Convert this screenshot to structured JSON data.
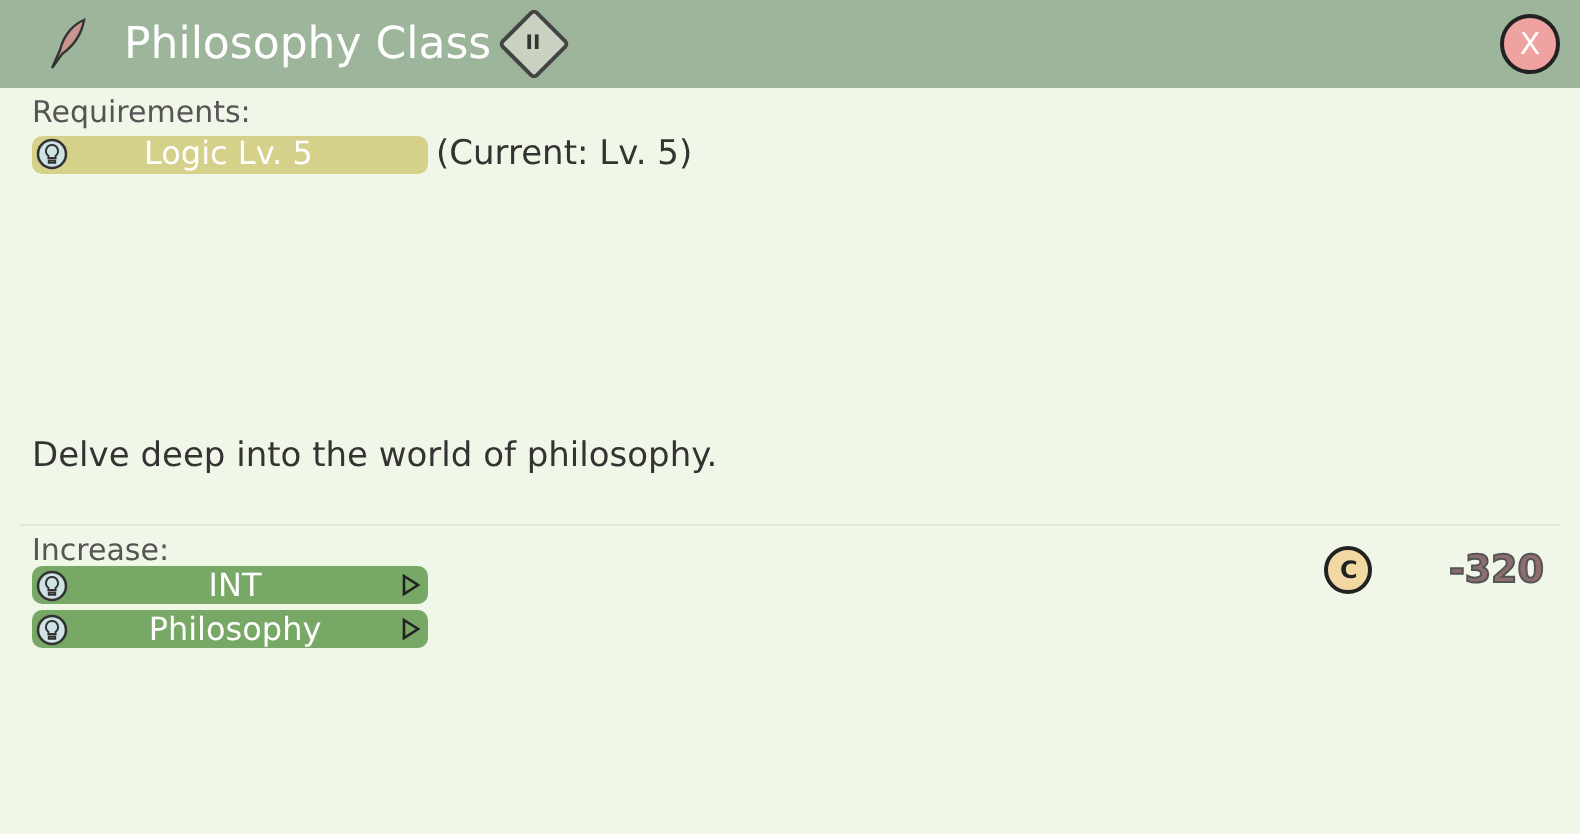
{
  "window": {
    "title": "Philosophy Class",
    "rank": "II",
    "close": "X"
  },
  "requirements": {
    "label": "Requirements:",
    "items": [
      {
        "name": "Logic Lv. 5",
        "current": "(Current: Lv. 5)"
      }
    ]
  },
  "description": "Delve deep into the world of philosophy.",
  "increase": {
    "label": "Increase:",
    "items": [
      {
        "name": "INT"
      },
      {
        "name": "Philosophy"
      }
    ]
  },
  "cost": {
    "coin": "C",
    "amount": "-320"
  }
}
